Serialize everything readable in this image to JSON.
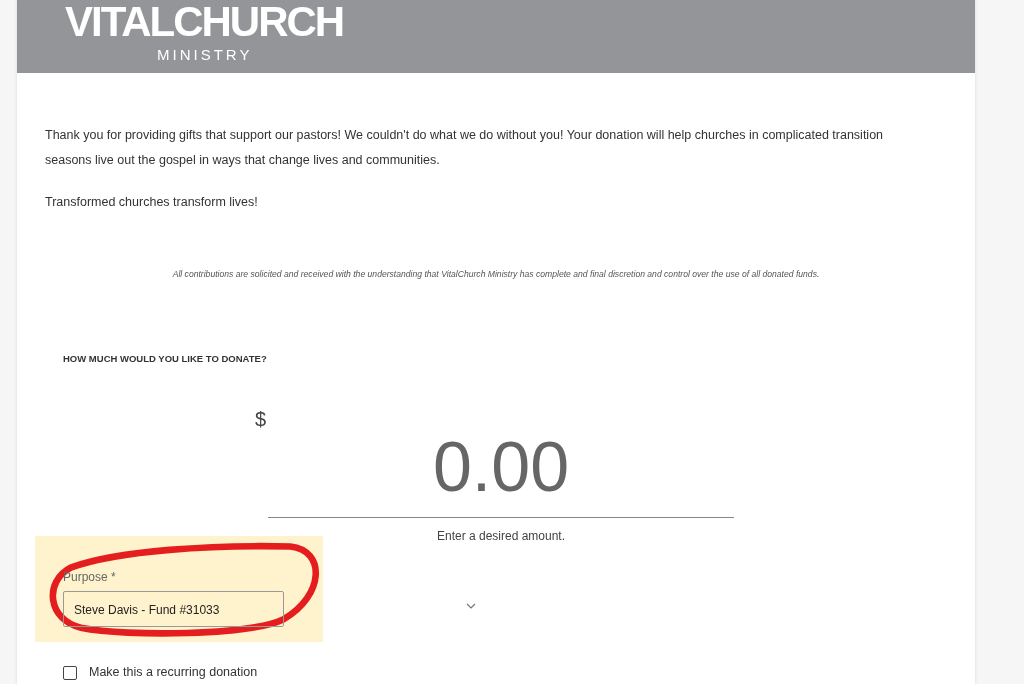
{
  "logo": {
    "name": "VITALCHURCH",
    "subtitle": "MINISTRY"
  },
  "intro": [
    "Thank you for providing gifts that support our pastors! We couldn't do what we do without you! Your donation will help churches in complicated transition seasons live out the gospel in ways that change lives and communities.",
    "Transformed churches transform lives!"
  ],
  "disclaimer": "All contributions are solicited and received with the understanding that VitalChurch Ministry has complete and final discretion and control over the use of all donated funds.",
  "donation": {
    "heading": "HOW MUCH WOULD YOU LIKE TO DONATE?",
    "currency": "$",
    "placeholder": "0.00",
    "hint": "Enter a desired amount."
  },
  "purpose": {
    "label": "Purpose *",
    "value": "Steve Davis - Fund #31033"
  },
  "recurring": {
    "label": "Make this a recurring donation",
    "checked": false
  }
}
